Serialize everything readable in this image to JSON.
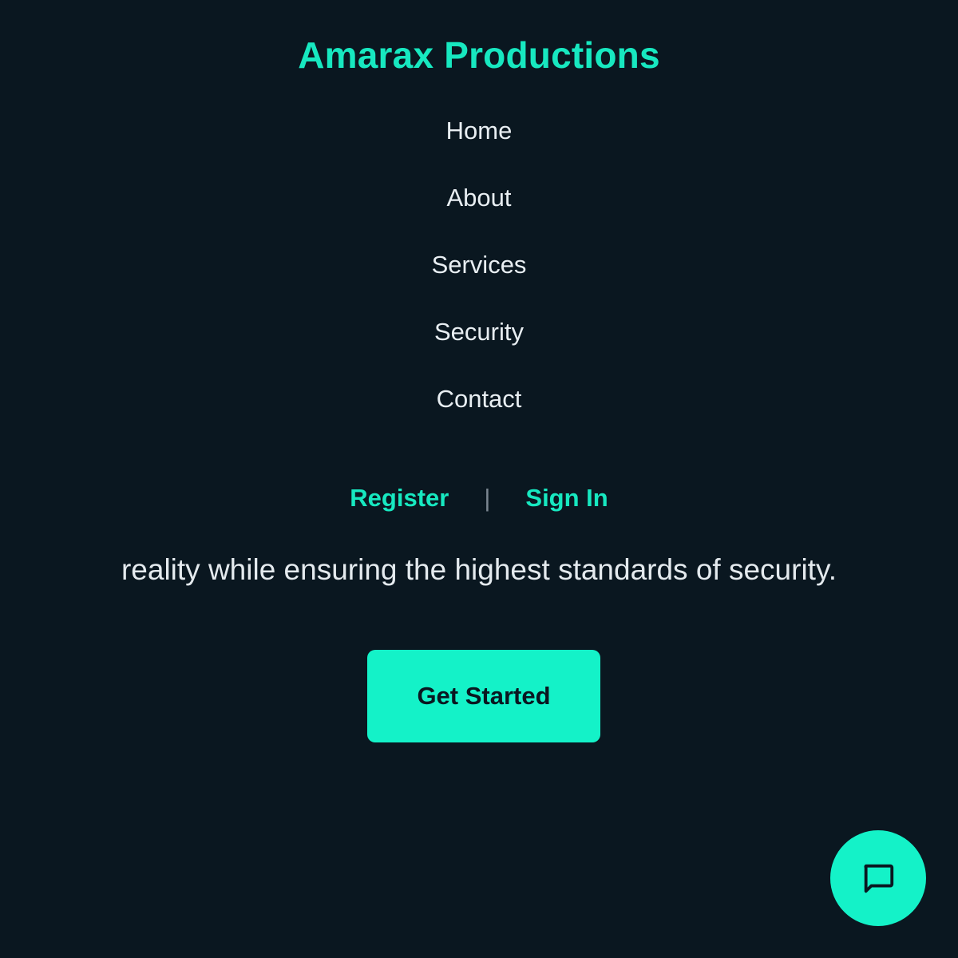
{
  "header": {
    "brand": "Amarax Productions"
  },
  "nav": {
    "items": [
      {
        "label": "Home"
      },
      {
        "label": "About"
      },
      {
        "label": "Services"
      },
      {
        "label": "Security"
      },
      {
        "label": "Contact"
      }
    ]
  },
  "auth": {
    "register_label": "Register",
    "separator": "|",
    "signin_label": "Sign In"
  },
  "hero": {
    "text": "reality while ensuring the highest standards of security.",
    "cta_label": "Get Started"
  },
  "chat": {
    "icon": "chat-bubble-icon"
  },
  "colors": {
    "background": "#0a1720",
    "accent": "#14f2c8",
    "brand": "#17e8c0",
    "text": "#e8eef2"
  }
}
